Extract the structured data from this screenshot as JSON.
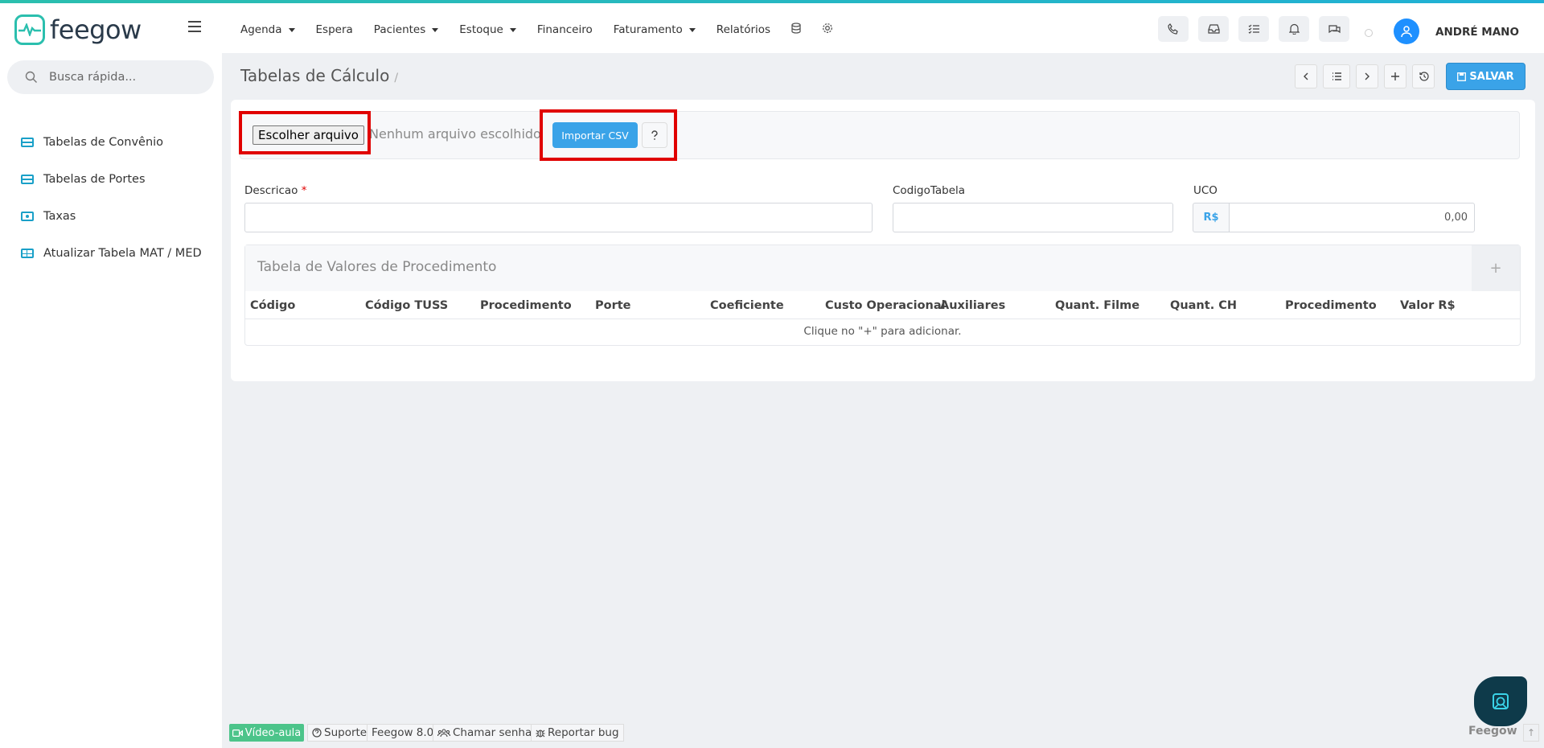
{
  "brand": {
    "name": "feegow"
  },
  "nav": {
    "items": [
      {
        "label": "Agenda",
        "dropdown": true
      },
      {
        "label": "Espera",
        "dropdown": false
      },
      {
        "label": "Pacientes",
        "dropdown": true
      },
      {
        "label": "Estoque",
        "dropdown": true
      },
      {
        "label": "Financeiro",
        "dropdown": false
      },
      {
        "label": "Faturamento",
        "dropdown": true
      },
      {
        "label": "Relatórios",
        "dropdown": false
      }
    ],
    "icons": [
      "database-icon",
      "gear-icon"
    ]
  },
  "header": {
    "buttons": [
      "phone-icon",
      "inbox-icon",
      "tasks-icon",
      "bell-icon",
      "chat-icon"
    ],
    "user_name": "ANDRÉ MANO"
  },
  "sidebar": {
    "search_placeholder": "Busca rápida...",
    "items": [
      {
        "label": "Tabelas de Convênio",
        "icon": "card-icon"
      },
      {
        "label": "Tabelas de Portes",
        "icon": "card-icon"
      },
      {
        "label": "Taxas",
        "icon": "money-icon"
      },
      {
        "label": "Atualizar Tabela MAT / MED",
        "icon": "table-icon"
      }
    ]
  },
  "page": {
    "title": "Tabelas de Cálculo",
    "separator": "/",
    "save_label": "SALVAR"
  },
  "import": {
    "file_button": "Escolher arquivo",
    "file_status": "Nenhum arquivo escolhido",
    "import_button": "Importar CSV",
    "help_icon": "question-icon"
  },
  "form": {
    "descricao_label": "Descricao",
    "required_mark": "*",
    "codigo_label": "CodigoTabela",
    "uco_label": "UCO",
    "uco_prefix": "R$",
    "uco_value": "0,00"
  },
  "table": {
    "title": "Tabela de Valores de Procedimento",
    "add_label": "+",
    "columns": [
      "Código",
      "Código TUSS",
      "Procedimento",
      "Porte",
      "Coeficiente",
      "Custo Operacional",
      "Auxiliares",
      "Quant. Filme",
      "Quant. CH",
      "Procedimento",
      "Valor R$"
    ],
    "empty_message": "Clique no  \"+\" para adicionar."
  },
  "footer": {
    "video": "Vídeo-aula",
    "support": "Suporte",
    "version": "Feegow 8.0",
    "call": "Chamar senha",
    "bug": "Reportar bug",
    "brand": "Feegow",
    "top": "↑"
  },
  "colors": {
    "accent": "#3aa3e8",
    "brand": "#2bbfae",
    "highlight": "#e00000",
    "video": "#4cc48a"
  }
}
